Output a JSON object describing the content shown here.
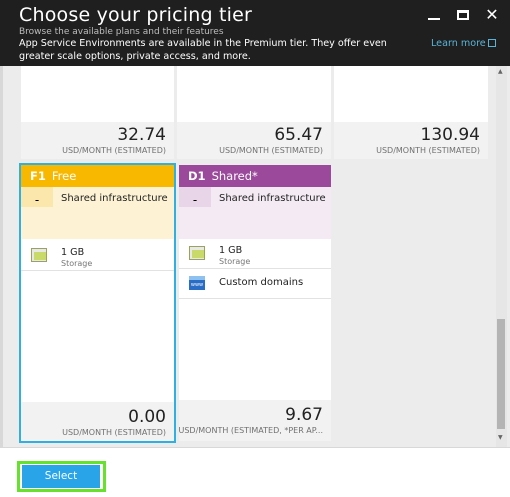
{
  "header": {
    "title": "Choose your pricing tier",
    "subtitle": "Browse the available plans and their features",
    "description": "App Service Environments are available in the Premium tier. They offer even greater scale options, private access, and more.",
    "learn_more": "Learn more"
  },
  "top_cards": [
    {
      "price": "32.74",
      "unit": "USD/MONTH (ESTIMATED)"
    },
    {
      "price": "65.47",
      "unit": "USD/MONTH (ESTIMATED)"
    },
    {
      "price": "130.94",
      "unit": "USD/MONTH (ESTIMATED)"
    }
  ],
  "tiers": [
    {
      "code": "F1",
      "name": "Free",
      "color": "#f9b800",
      "selected": true,
      "feature_mark": "-",
      "feature": "Shared infrastructure",
      "storage_title": "1 GB",
      "storage_sub": "Storage",
      "price": "0.00",
      "unit": "USD/MONTH (ESTIMATED)"
    },
    {
      "code": "D1",
      "name": "Shared*",
      "color": "#9b4a9b",
      "selected": false,
      "feature_mark": "-",
      "feature": "Shared infrastructure",
      "storage_title": "1 GB",
      "storage_sub": "Storage",
      "extra_item": "Custom domains",
      "extra_icon_text": "www",
      "price": "9.67",
      "unit": "USD/MONTH (ESTIMATED, *PER AP..."
    }
  ],
  "footer": {
    "select_label": "Select"
  },
  "colors": {
    "accent": "#2aa4e8",
    "selection_border": "#2fb0e0",
    "highlight_outline": "#67e22c"
  }
}
